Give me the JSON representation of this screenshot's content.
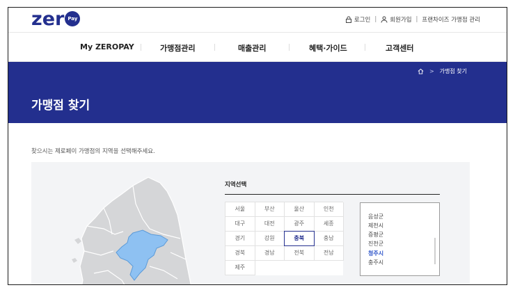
{
  "header": {
    "logo_text": "zer",
    "logo_badge": "Pay",
    "util_links": [
      {
        "label": "로그인",
        "icon": "lock-icon"
      },
      {
        "label": "회원가입",
        "icon": "person-icon"
      },
      {
        "label": "프랜차이즈 가맹점 관리",
        "icon": ""
      }
    ]
  },
  "gnb": {
    "items": [
      "My ZEROPAY",
      "가맹점관리",
      "매출관리",
      "혜택·가이드",
      "고객센터"
    ]
  },
  "breadcrumb": {
    "home_icon": "home-icon",
    "arrow": ">",
    "current": "가맹점 찾기"
  },
  "page": {
    "title": "가맹점 찾기",
    "description": "찾으시는 제로페이 가맹점의 지역을 선택해주세요."
  },
  "region": {
    "title": "지역선택",
    "options": [
      "서울",
      "부산",
      "울산",
      "인천",
      "대구",
      "대전",
      "광주",
      "세종",
      "경기",
      "강원",
      "충북",
      "충남",
      "경북",
      "경남",
      "전북",
      "전남",
      "제주"
    ],
    "selected": "충북"
  },
  "district_list": {
    "items": [
      "음성군",
      "제천시",
      "증평군",
      "진천군",
      "청주시",
      "충주시"
    ],
    "selected": "청주시"
  },
  "colors": {
    "brand": "#232f8e",
    "map_highlight": "#8ec1f2",
    "map_land": "#d5d6d8",
    "selected_text": "#2b52c8"
  }
}
